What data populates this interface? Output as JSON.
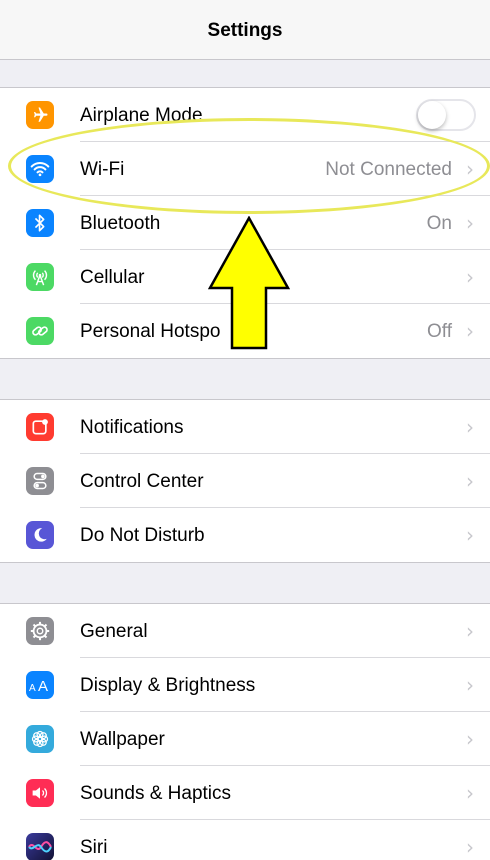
{
  "nav": {
    "title": "Settings"
  },
  "groups": [
    {
      "items": [
        {
          "label": "Airplane Mode",
          "icon": "airplane-icon",
          "color": "#ff9500",
          "control": "toggle",
          "toggle_on": false
        },
        {
          "label": "Wi-Fi",
          "icon": "wifi-icon",
          "color": "#0a84ff",
          "value": "Not Connected"
        },
        {
          "label": "Bluetooth",
          "icon": "bluetooth-icon",
          "color": "#0a84ff",
          "value": "On"
        },
        {
          "label": "Cellular",
          "icon": "cellular-antenna-icon",
          "color": "#4cd964",
          "value": ""
        },
        {
          "label": "Personal Hotspo",
          "icon": "hotspot-icon",
          "color": "#4cd964",
          "value": "Off"
        }
      ]
    },
    {
      "items": [
        {
          "label": "Notifications",
          "icon": "notifications-icon",
          "color": "#ff3b30",
          "value": ""
        },
        {
          "label": "Control Center",
          "icon": "control-center-icon",
          "color": "#8e8e93",
          "value": ""
        },
        {
          "label": "Do Not Disturb",
          "icon": "moon-icon",
          "color": "#5856d6",
          "value": ""
        }
      ]
    },
    {
      "items": [
        {
          "label": "General",
          "icon": "gear-icon",
          "color": "#8e8e93",
          "value": ""
        },
        {
          "label": "Display & Brightness",
          "icon": "text-size-icon",
          "color": "#0a84ff",
          "value": ""
        },
        {
          "label": "Wallpaper",
          "icon": "wallpaper-flower-icon",
          "color": "#34aadc",
          "value": ""
        },
        {
          "label": "Sounds & Haptics",
          "icon": "speaker-icon",
          "color": "#ff2d55",
          "value": ""
        },
        {
          "label": "Siri",
          "icon": "siri-icon",
          "color": "#3a3a9c",
          "value": ""
        }
      ]
    }
  ],
  "annotation": {
    "highlight_color": "#e8e85a",
    "arrow_color": "#ffff00"
  }
}
